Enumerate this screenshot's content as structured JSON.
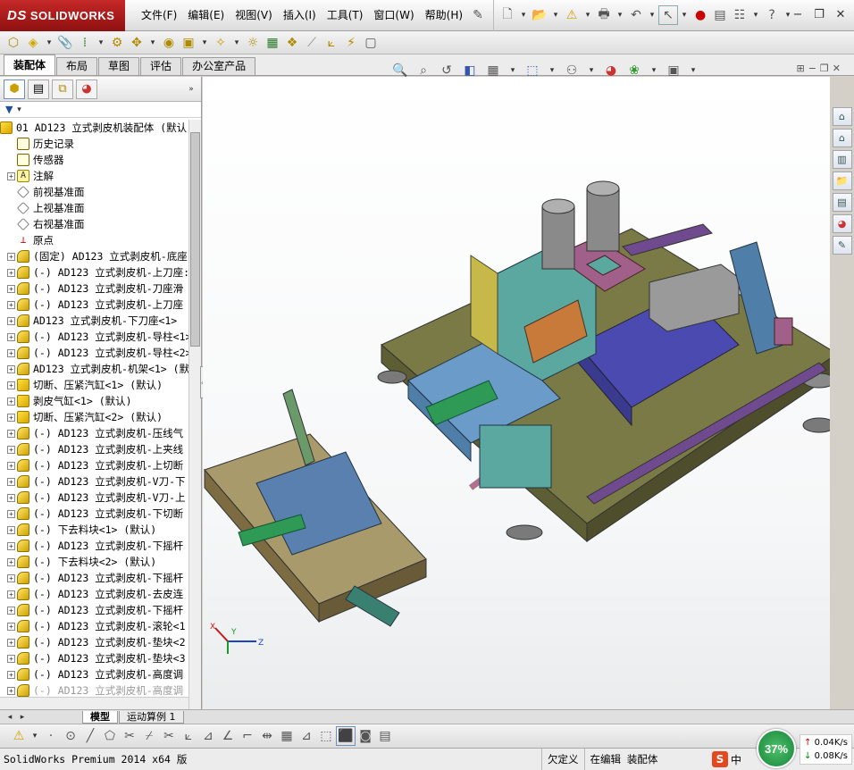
{
  "app": {
    "brand": "SOLIDWORKS",
    "brand_prefix": "DS"
  },
  "menu": [
    "文件(F)",
    "编辑(E)",
    "视图(V)",
    "插入(I)",
    "工具(T)",
    "窗口(W)",
    "帮助(H)"
  ],
  "command_tabs": [
    "装配体",
    "布局",
    "草图",
    "评估",
    "办公室产品"
  ],
  "tree": {
    "root": "01 AD123 立式剥皮机装配体  (默认",
    "items": [
      {
        "icon": "hist",
        "exp": false,
        "text": "历史记录"
      },
      {
        "icon": "hist",
        "exp": false,
        "text": "传感器"
      },
      {
        "icon": "ann",
        "exp": true,
        "text": "注解"
      },
      {
        "icon": "plane",
        "exp": false,
        "text": "前视基准面"
      },
      {
        "icon": "plane",
        "exp": false,
        "text": "上视基准面"
      },
      {
        "icon": "plane",
        "exp": false,
        "text": "右视基准面"
      },
      {
        "icon": "origin",
        "exp": false,
        "text": "原点"
      },
      {
        "icon": "part",
        "exp": true,
        "text": "(固定) AD123 立式剥皮机-底座"
      },
      {
        "icon": "part",
        "exp": true,
        "text": "(-) AD123 立式剥皮机-上刀座:"
      },
      {
        "icon": "part",
        "exp": true,
        "text": "(-) AD123 立式剥皮机-刀座滑"
      },
      {
        "icon": "part",
        "exp": true,
        "text": "(-) AD123 立式剥皮机-上刀座"
      },
      {
        "icon": "part",
        "exp": true,
        "text": "AD123 立式剥皮机-下刀座<1>"
      },
      {
        "icon": "part",
        "exp": true,
        "text": "(-) AD123 立式剥皮机-导柱<1>"
      },
      {
        "icon": "part",
        "exp": true,
        "text": "(-) AD123 立式剥皮机-导柱<2>"
      },
      {
        "icon": "part",
        "exp": true,
        "text": "AD123 立式剥皮机-机架<1> (默"
      },
      {
        "icon": "asm",
        "exp": true,
        "text": "切断、压紧汽缸<1> (默认)"
      },
      {
        "icon": "asm",
        "exp": true,
        "text": "剥皮气缸<1> (默认)"
      },
      {
        "icon": "asm",
        "exp": true,
        "text": "切断、压紧汽缸<2> (默认)"
      },
      {
        "icon": "part",
        "exp": true,
        "text": "(-) AD123 立式剥皮机-压线气"
      },
      {
        "icon": "part",
        "exp": true,
        "text": "(-) AD123 立式剥皮机-上夹线"
      },
      {
        "icon": "part",
        "exp": true,
        "text": "(-) AD123 立式剥皮机-上切断"
      },
      {
        "icon": "part",
        "exp": true,
        "text": "(-) AD123 立式剥皮机-V刀-下"
      },
      {
        "icon": "part",
        "exp": true,
        "text": "(-) AD123 立式剥皮机-V刀-上"
      },
      {
        "icon": "part",
        "exp": true,
        "text": "(-) AD123 立式剥皮机-下切断"
      },
      {
        "icon": "part",
        "exp": true,
        "text": "(-) 下去料块<1> (默认)"
      },
      {
        "icon": "part",
        "exp": true,
        "text": "(-) AD123 立式剥皮机-下摇杆"
      },
      {
        "icon": "part",
        "exp": true,
        "text": "(-) 下去料块<2> (默认)"
      },
      {
        "icon": "part",
        "exp": true,
        "text": "(-) AD123 立式剥皮机-下摇杆"
      },
      {
        "icon": "part",
        "exp": true,
        "text": "(-) AD123 立式剥皮机-去皮连"
      },
      {
        "icon": "part",
        "exp": true,
        "text": "(-) AD123 立式剥皮机-下摇杆"
      },
      {
        "icon": "part",
        "exp": true,
        "text": "(-) AD123 立式剥皮机-滚轮<1"
      },
      {
        "icon": "part",
        "exp": true,
        "text": "(-) AD123 立式剥皮机-垫块<2"
      },
      {
        "icon": "part",
        "exp": true,
        "text": "(-) AD123 立式剥皮机-垫块<3"
      },
      {
        "icon": "part",
        "exp": true,
        "text": "(-) AD123 立式剥皮机-高度调"
      },
      {
        "icon": "part",
        "exp": true,
        "text": "(-) AD123 立式剥皮机-高度调",
        "faded": true
      }
    ]
  },
  "bottom_tabs": [
    "模型",
    "运动算例 1"
  ],
  "triad": {
    "x": "X",
    "y": "Y",
    "z": "Z"
  },
  "status": {
    "product": "SolidWorks Premium 2014 x64 版",
    "state": "欠定义",
    "mode": "在编辑 装配体"
  },
  "netmon": {
    "percent": "37%",
    "up": "0.04K/s",
    "down": "0.08K/s"
  },
  "ime": {
    "label": "中"
  }
}
